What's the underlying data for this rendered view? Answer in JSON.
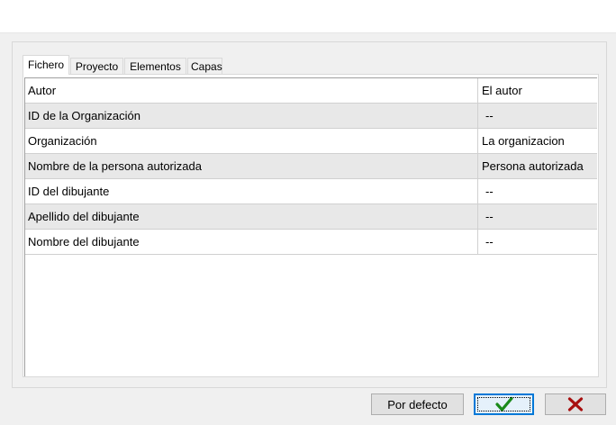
{
  "tabs": [
    {
      "label": "Fichero",
      "active": true
    },
    {
      "label": "Proyecto",
      "active": false
    },
    {
      "label": "Elementos",
      "active": false
    },
    {
      "label": "Capas",
      "active": false
    }
  ],
  "properties": [
    {
      "key": "Autor",
      "value": "El autor"
    },
    {
      "key": "ID de la Organización",
      "value": "--"
    },
    {
      "key": "Organización",
      "value": "La organizacion"
    },
    {
      "key": "Nombre de la persona autorizada",
      "value": "Persona autorizada"
    },
    {
      "key": "ID del dibujante",
      "value": "--"
    },
    {
      "key": "Apellido del dibujante",
      "value": "--"
    },
    {
      "key": "Nombre del dibujante",
      "value": "--"
    }
  ],
  "buttons": {
    "default_label": "Por defecto",
    "ok_icon": "check-icon",
    "cancel_icon": "close-icon"
  },
  "colors": {
    "ok_check": "#1a8a1a",
    "cancel_x": "#a80f0f",
    "row_alt": "#e8e8e8"
  }
}
